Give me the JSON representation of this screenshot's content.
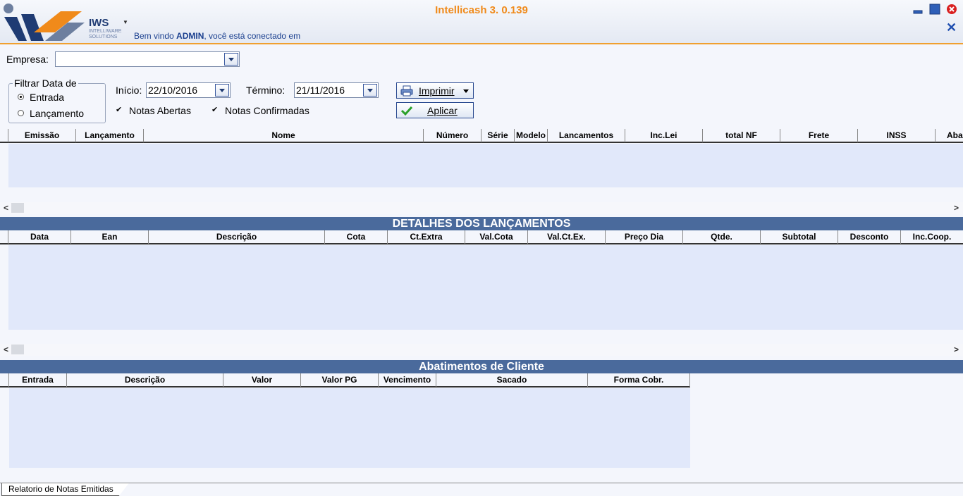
{
  "header": {
    "app_title": "Intellicash 3. 0.139",
    "logo_text": "IWS",
    "logo_sub": "INTELLIWARE SOLUTIONS",
    "welcome_prefix": "Bem vindo ",
    "welcome_user": "ADMIN",
    "welcome_suffix": ", você está conectado em"
  },
  "filters": {
    "empresa_label": "Empresa:",
    "empresa_value": "",
    "group_title": "Filtrar Data de",
    "radio_entrada": "Entrada",
    "radio_lancamento": "Lançamento",
    "selected": "Entrada",
    "inicio_label": "Início:",
    "inicio_value": "22/10/2016",
    "termino_label": "Término:",
    "termino_value": "21/11/2016",
    "check_notas_abertas": "Notas Abertas",
    "check_notas_confirmadas": "Notas Confirmadas",
    "imprimir_label": "Imprimir",
    "aplicar_label": "Aplicar"
  },
  "notes_grid": {
    "columns": [
      "Emissão",
      "Lançamento",
      "Nome",
      "Número",
      "Série",
      "Modelo",
      "Lancamentos",
      "Inc.Lei",
      "total NF",
      "Frete",
      "INSS",
      "Aba"
    ]
  },
  "details": {
    "title": "DETALHES DOS LANÇAMENTOS",
    "columns": [
      "Data",
      "Ean",
      "Descrição",
      "Cota",
      "Ct.Extra",
      "Val.Cota",
      "Val.Ct.Ex.",
      "Preço Dia",
      "Qtde.",
      "Subtotal",
      "Desconto",
      "Inc.Coop."
    ]
  },
  "abatimentos": {
    "title": "Abatimentos de Cliente",
    "columns": [
      "Entrada",
      "Descrição",
      "Valor",
      "Valor PG",
      "Vencimento",
      "Sacado",
      "Forma Cobr."
    ]
  },
  "scroll": {
    "left": "<",
    "right": ">"
  },
  "tabs": {
    "active": "Relatorio de Notas Emitidas"
  },
  "colors": {
    "accent": "#f08a1a",
    "section": "#4a6a9c",
    "grid_body": "#e1e8fa"
  }
}
